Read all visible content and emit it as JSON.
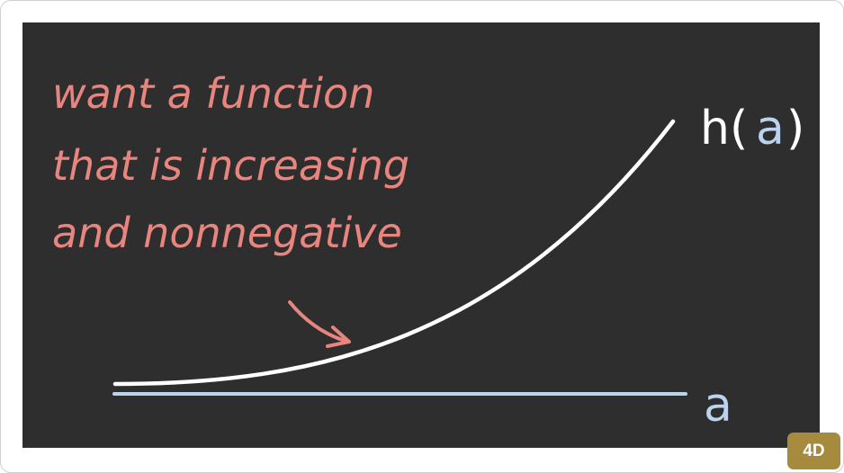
{
  "note": {
    "lines": [
      "want a function",
      "that is increasing",
      "and nonnegative"
    ]
  },
  "labels": {
    "function": "h(",
    "function_arg": "a",
    "function_close": ")",
    "axis": "a"
  },
  "badge": "4D",
  "colors": {
    "board": "#2e2e2e",
    "note": "#e8857f",
    "curve": "#ffffff",
    "axis": "#bcd3f0",
    "badge": "#a68a3e"
  }
}
